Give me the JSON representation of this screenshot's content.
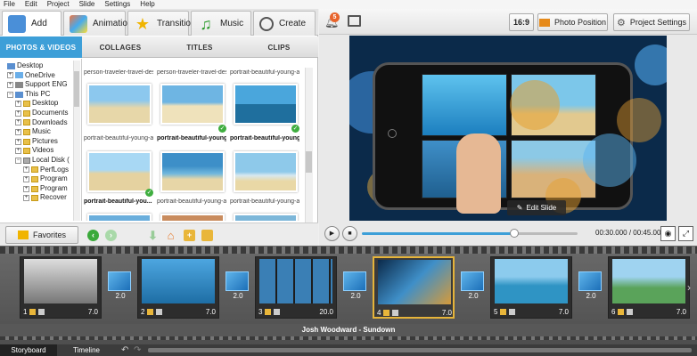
{
  "menu": [
    "File",
    "Edit",
    "Project",
    "Slide",
    "Settings",
    "Help"
  ],
  "top_tabs": [
    "Add",
    "Animation",
    "Transitions",
    "Music",
    "Create"
  ],
  "sub_tabs": [
    "PHOTOS & VIDEOS",
    "COLLAGES",
    "TITLES",
    "CLIPS"
  ],
  "tree": [
    "Desktop",
    "OneDrive",
    "Support ENG",
    "This PC",
    "Desktop",
    "Documents",
    "Downloads",
    "Music",
    "Pictures",
    "Videos",
    "Local Disk (",
    "PerfLogs",
    "Program",
    "Program",
    "Recover"
  ],
  "files": {
    "top_captions": [
      "person-traveler-travel-des...",
      "person-traveler-travel-des...",
      "portrait-beautiful-young-a..."
    ],
    "row1": [
      "portrait-beautiful-young-a...",
      "portrait-beautiful-young-a...",
      "portrait-beautiful-young-a..."
    ],
    "row2": [
      "portrait-beautiful-you...",
      "portrait-beautiful-young-a...",
      "portrait-beautiful-young-a..."
    ]
  },
  "favorites_label": "Favorites",
  "right_toolbar": {
    "notifications_count": "5",
    "aspect": "16:9",
    "photo_position": "Photo Position",
    "project_settings": "Project Settings"
  },
  "preview": {
    "edit_slide": "Edit Slide"
  },
  "player": {
    "time": "00:30.000 / 00:45.000"
  },
  "slides": [
    {
      "num": "1",
      "duration": "7.0",
      "trans": "2.0"
    },
    {
      "num": "2",
      "duration": "7.0",
      "trans": "2.0"
    },
    {
      "num": "3",
      "duration": "20.0",
      "trans": "2.0"
    },
    {
      "num": "4",
      "duration": "7.0",
      "trans": "2.0"
    },
    {
      "num": "5",
      "duration": "7.0",
      "trans": "2.0"
    },
    {
      "num": "6",
      "duration": "7.0"
    }
  ],
  "audio_track": "Josh Woodward - Sundown",
  "bottom_tabs": [
    "Storyboard",
    "Timeline"
  ]
}
